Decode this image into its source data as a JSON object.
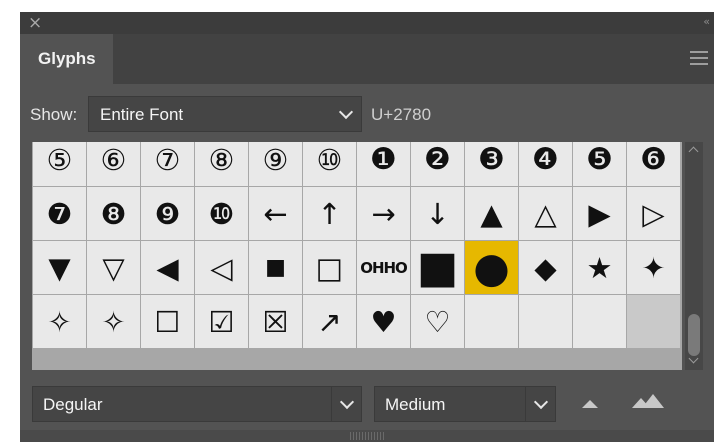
{
  "panel": {
    "title_close": "×",
    "collapse": "‹‹",
    "tab": "Glyphs"
  },
  "show": {
    "label": "Show:",
    "value": "Entire Font",
    "codepoint": "U+2780"
  },
  "glyphs": [
    [
      "⑤",
      "⑥",
      "⑦",
      "⑧",
      "⑨",
      "⑩",
      "❶",
      "❷",
      "❸",
      "❹",
      "❺",
      "❻"
    ],
    [
      "❼",
      "❽",
      "❾",
      "❿",
      "←",
      "↑",
      "→",
      "↓",
      "▲",
      "△",
      "▶",
      "▷"
    ],
    [
      "▼",
      "▽",
      "◀",
      "◁",
      "■",
      "□",
      "ОННО",
      "■",
      "●",
      "◆",
      "★",
      "✦"
    ],
    [
      "✧",
      "✧",
      "☐",
      "☑",
      "☒",
      "↗",
      "♥",
      "♡",
      "",
      "",
      "",
      ""
    ]
  ],
  "selected_glyph": "●",
  "font": {
    "family": "Degular",
    "style": "Medium"
  },
  "colors": {
    "selection": "#e6b800",
    "panel": "#535353",
    "cell": "#e9e9e9"
  },
  "icons": [
    "close-icon",
    "collapse-icon",
    "panel-menu-icon",
    "chevron-down-icon",
    "zoom-out-icon",
    "zoom-in-icon"
  ]
}
